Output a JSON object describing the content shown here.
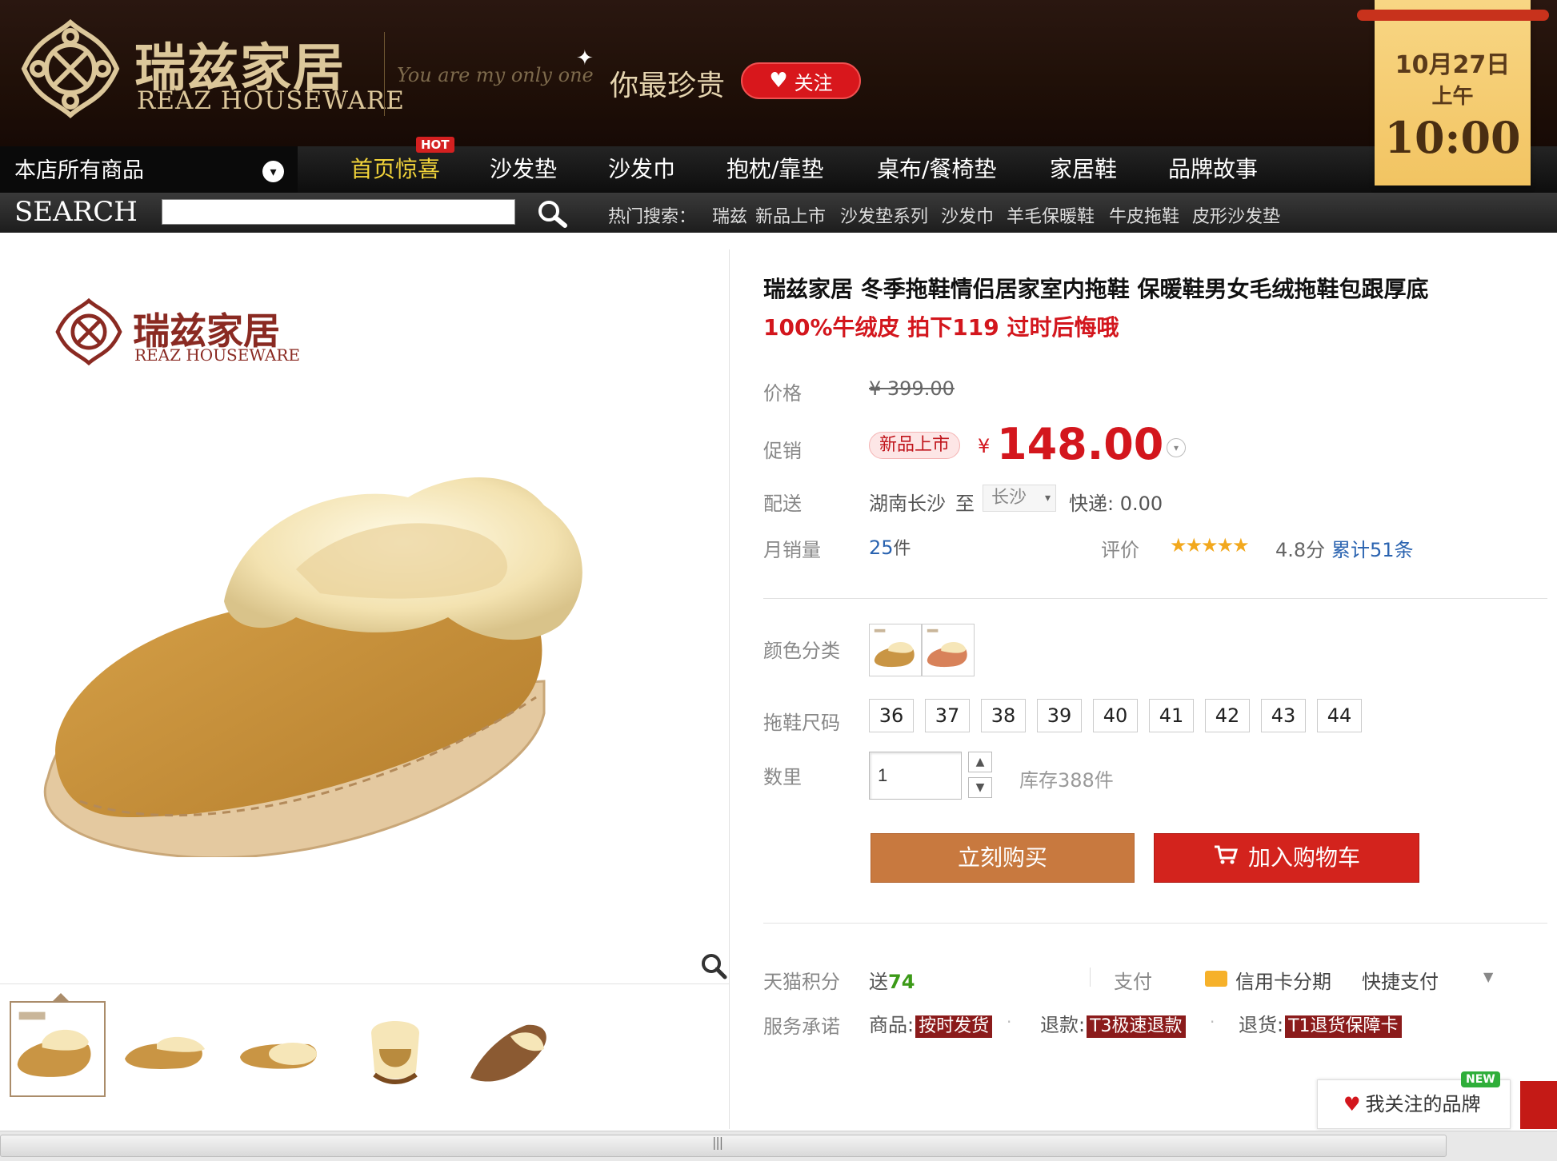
{
  "header": {
    "brand_cn": "瑞兹家居",
    "brand_en": "REAZ HOUSEWARE",
    "slogan_en": "You are my only one",
    "slogan_cn": "你最珍贵",
    "follow_label": "关注",
    "calendar": {
      "date": "10月27日",
      "period": "上午",
      "time": "10:00"
    }
  },
  "nav": {
    "all_products": "本店所有商品",
    "hot_badge": "HOT",
    "items": [
      "首页惊喜",
      "沙发垫",
      "沙发巾",
      "抱枕/靠垫",
      "桌布/餐椅垫",
      "家居鞋",
      "品牌故事"
    ]
  },
  "search": {
    "label": "SEARCH",
    "placeholder": "",
    "hot_label": "热门搜索：",
    "hot_keywords": [
      "瑞兹",
      "新品上市",
      "沙发垫系列",
      "沙发巾",
      "羊毛保暖鞋",
      "牛皮拖鞋",
      "皮形沙发垫"
    ]
  },
  "gallery": {
    "store_logo_cn": "瑞兹家居",
    "store_logo_en": "REAZ HOUSEWARE",
    "thumbnail_count": 5
  },
  "product": {
    "title_line1": "瑞兹家居 冬季拖鞋情侣居家室内拖鞋 保暖鞋男女毛绒拖鞋包跟厚底",
    "title_line2": "100%牛绒皮 拍下119 过时后悔哦",
    "price_label": "价格",
    "original_price": "¥ 399.00",
    "promo_label": "促销",
    "promo_tag": "新品上市",
    "currency": "¥",
    "promo_price": "148.00",
    "shipping_label": "配送",
    "ship_from": "湖南长沙",
    "ship_to_word": "至",
    "ship_city": "长沙",
    "ship_fee": "快递: 0.00",
    "monthly_sales_label": "月销量",
    "monthly_sales": "25",
    "monthly_sales_unit": "件",
    "rating_label": "评价",
    "rating_stars": "★★★★★",
    "rating_score": "4.8分",
    "review_count": "累计51条",
    "color_label": "颜色分类",
    "colors": [
      "camel",
      "orange"
    ],
    "size_label": "拖鞋尺码",
    "sizes": [
      "36",
      "37",
      "38",
      "39",
      "40",
      "41",
      "42",
      "43",
      "44"
    ],
    "qty_label": "数里",
    "qty_value": "1",
    "stock": "库存388件",
    "buy_now": "立刻购买",
    "add_to_cart": "加入购物车",
    "points_label": "天猫积分",
    "points_prefix": "送",
    "points_value": "74",
    "pay_label": "支付",
    "installment": "信用卡分期",
    "quick_pay": "快捷支付",
    "service_label": "服务承诺",
    "services": [
      {
        "prefix": "商品:",
        "badge": "按时发货"
      },
      {
        "prefix": "退款:",
        "badge": "T3极速退款"
      },
      {
        "prefix": "退货:",
        "badge": "T1退货保障卡"
      }
    ]
  },
  "floating": {
    "my_brands": "我关注的品牌",
    "new_badge": "NEW"
  },
  "colors": {
    "accent_red": "#d3161d",
    "buy_now": "#c8793f",
    "header_bg": "#201008",
    "gold": "#dcc79a"
  }
}
